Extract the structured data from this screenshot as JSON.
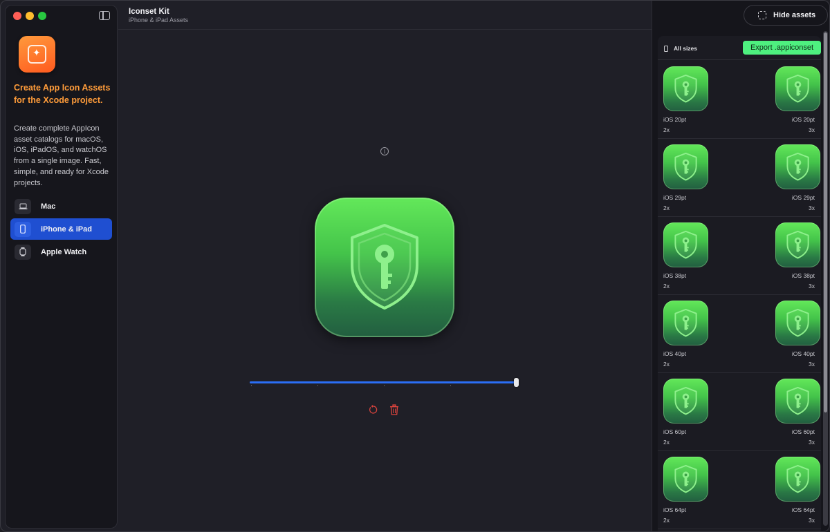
{
  "window": {
    "title": "Iconset Kit",
    "subtitle": "iPhone & iPad Assets"
  },
  "sidebar": {
    "headline": "Create App Icon Assets for the Xcode project.",
    "description": "Create complete AppIcon asset catalogs for macOS, iOS, iPadOS, and watchOS from a single image. Fast, simple, and ready for Xcode projects.",
    "items": [
      {
        "label": "Mac",
        "icon": "laptop-icon",
        "active": false
      },
      {
        "label": "iPhone & iPad",
        "icon": "phone-icon",
        "active": true
      },
      {
        "label": "Apple Watch",
        "icon": "watch-icon",
        "active": false
      }
    ]
  },
  "editor": {
    "slider_value": 1.0,
    "info_icon": "info-icon",
    "reset_icon": "reset-icon",
    "delete_icon": "trash-icon"
  },
  "assets_panel": {
    "hide_label": "Hide assets",
    "filter_label": "All sizes",
    "export_label": "Export .appiconset",
    "rows": [
      {
        "left": {
          "name": "iOS 20pt",
          "scale": "2x"
        },
        "right": {
          "name": "iOS 20pt",
          "scale": "3x"
        }
      },
      {
        "left": {
          "name": "iOS 29pt",
          "scale": "2x"
        },
        "right": {
          "name": "iOS 29pt",
          "scale": "3x"
        }
      },
      {
        "left": {
          "name": "iOS 38pt",
          "scale": "2x"
        },
        "right": {
          "name": "iOS 38pt",
          "scale": "3x"
        }
      },
      {
        "left": {
          "name": "iOS 40pt",
          "scale": "2x"
        },
        "right": {
          "name": "iOS 40pt",
          "scale": "3x"
        }
      },
      {
        "left": {
          "name": "iOS 60pt",
          "scale": "2x"
        },
        "right": {
          "name": "iOS 60pt",
          "scale": "3x"
        }
      },
      {
        "left": {
          "name": "iOS 64pt",
          "scale": "2x"
        },
        "right": {
          "name": "iOS 64pt",
          "scale": "3x"
        }
      }
    ]
  },
  "colors": {
    "accent": "#1f4fd1",
    "headline": "#ff9c3a",
    "export": "#4ef07f",
    "danger": "#e0443e",
    "icon_green": "#44c44a"
  }
}
